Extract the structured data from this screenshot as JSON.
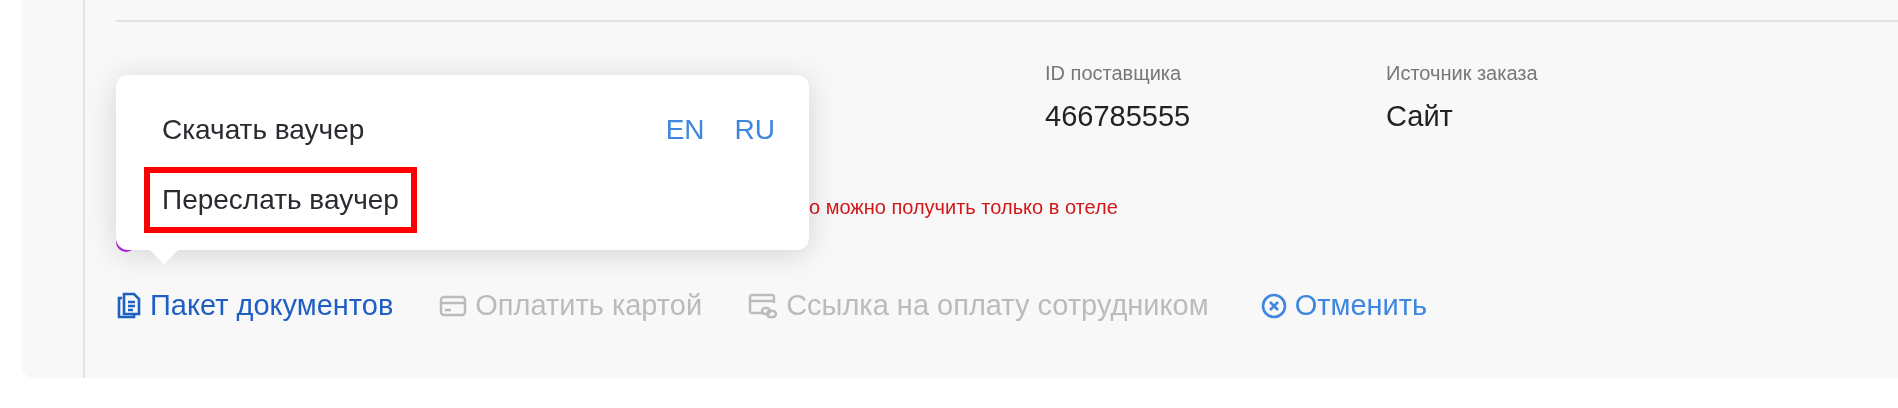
{
  "fields": [
    {
      "label": "ID поставщика",
      "value": "466785555"
    },
    {
      "label": "Источник заказа",
      "value": "Сайт"
    }
  ],
  "notice": "о можно получить только в отеле",
  "actions": [
    {
      "label": "Пакет документов",
      "kind": "documents",
      "disabled": false
    },
    {
      "label": "Оплатить картой",
      "kind": "card",
      "disabled": true
    },
    {
      "label": "Ссылка на оплату сотрудником",
      "kind": "link",
      "disabled": true
    },
    {
      "label": "Отменить",
      "kind": "cancel",
      "disabled": false
    }
  ],
  "voucher_menu": {
    "items": [
      {
        "label": "Скачать ваучер",
        "highlighted": false,
        "languages": [
          "EN",
          "RU"
        ]
      },
      {
        "label": "Переслать ваучер",
        "highlighted": true
      }
    ]
  }
}
